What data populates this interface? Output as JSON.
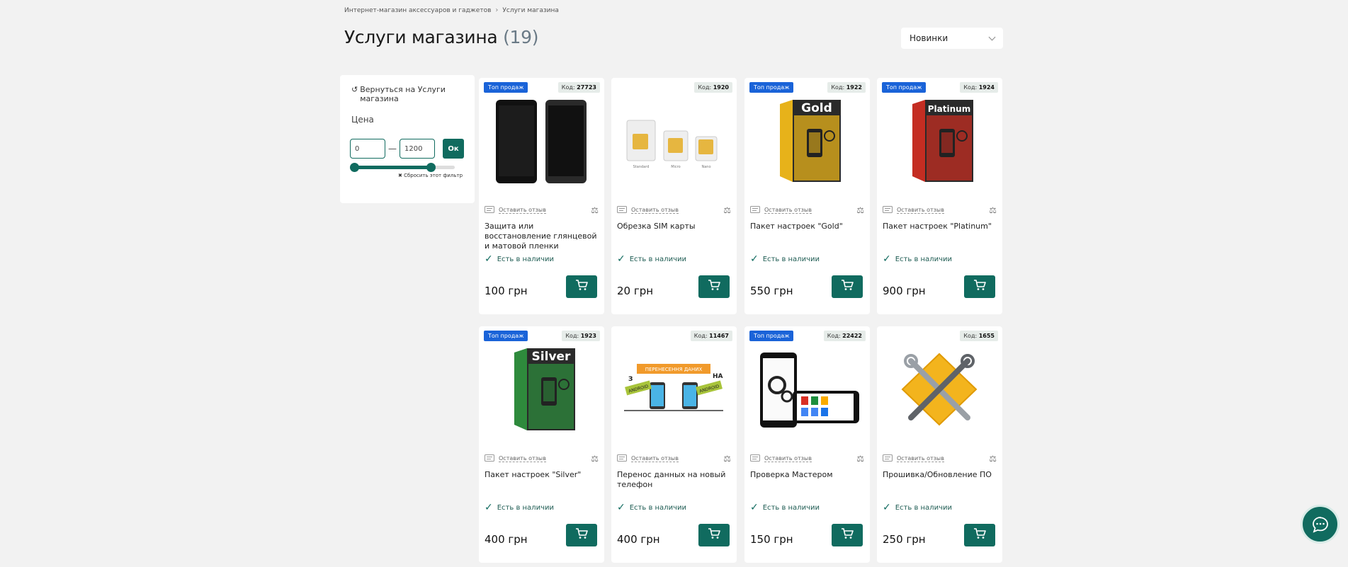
{
  "breadcrumb": {
    "home": "Интернет-магазин аксессуаров и гаджетов",
    "current": "Услуги магазина"
  },
  "page": {
    "title": "Услуги магазина",
    "count": "(19)"
  },
  "sort": {
    "selected": "Новинки"
  },
  "filter": {
    "back_label": "Вернуться на Услуги магазина",
    "price_label": "Цена",
    "min_value": "0",
    "max_value": "1200",
    "ok_label": "Ок",
    "reset_label": "Сбросить этот фильтр"
  },
  "products": [
    {
      "badge": "Топ продаж",
      "code_label": "Код:",
      "code": "27723",
      "review": "Оставить отзыв",
      "name": "Защита или восстановление глянцевой и матовой пленки",
      "stock": "Есть в наличии",
      "price": "100 грн",
      "image": "phones-icon"
    },
    {
      "badge": "",
      "code_label": "Код:",
      "code": "1920",
      "review": "Оставить отзыв",
      "name": "Обрезка SIM карты",
      "stock": "Есть в наличии",
      "price": "20 грн",
      "image": "sim-cards-icon"
    },
    {
      "badge": "Топ продаж",
      "code_label": "Код:",
      "code": "1922",
      "review": "Оставить отзыв",
      "name": "Пакет настроек \"Gold\"",
      "stock": "Есть в наличии",
      "price": "550 грн",
      "image": "gold-box-icon"
    },
    {
      "badge": "Топ продаж",
      "code_label": "Код:",
      "code": "1924",
      "review": "Оставить отзыв",
      "name": "Пакет настроек \"Platinum\"",
      "stock": "Есть в наличии",
      "price": "900 грн",
      "image": "platinum-box-icon"
    },
    {
      "badge": "Топ продаж",
      "code_label": "Код:",
      "code": "1923",
      "review": "Оставить отзыв",
      "name": "Пакет настроек \"Silver\"",
      "stock": "Есть в наличии",
      "price": "400 грн",
      "image": "silver-box-icon"
    },
    {
      "badge": "",
      "code_label": "Код:",
      "code": "11467",
      "review": "Оставить отзыв",
      "name": "Перенос данных на новый телефон",
      "stock": "Есть в наличии",
      "price": "400 грн",
      "image": "data-transfer-icon"
    },
    {
      "badge": "Топ продаж",
      "code_label": "Код:",
      "code": "22422",
      "review": "Оставить отзыв",
      "name": "Проверка Мастером",
      "stock": "Есть в наличии",
      "price": "150 грн",
      "image": "master-check-icon"
    },
    {
      "badge": "",
      "code_label": "Код:",
      "code": "1655",
      "review": "Оставить отзыв",
      "name": "Прошивка/Обновление ПО",
      "stock": "Есть в наличии",
      "price": "250 грн",
      "image": "firmware-tools-icon"
    }
  ],
  "box_labels": {
    "gold": "Gold",
    "platinum": "Platinum",
    "silver": "Silver",
    "transfer": "ПЕРЕНЕСЕННЯ ДАНИХ",
    "from": "З",
    "to": "НА",
    "android": "ANDROID",
    "sim_std": "Standard",
    "sim_micro": "Micro",
    "sim_nano": "Nano"
  },
  "colors": {
    "accent": "#106b5f",
    "badge": "#1a63d8"
  }
}
